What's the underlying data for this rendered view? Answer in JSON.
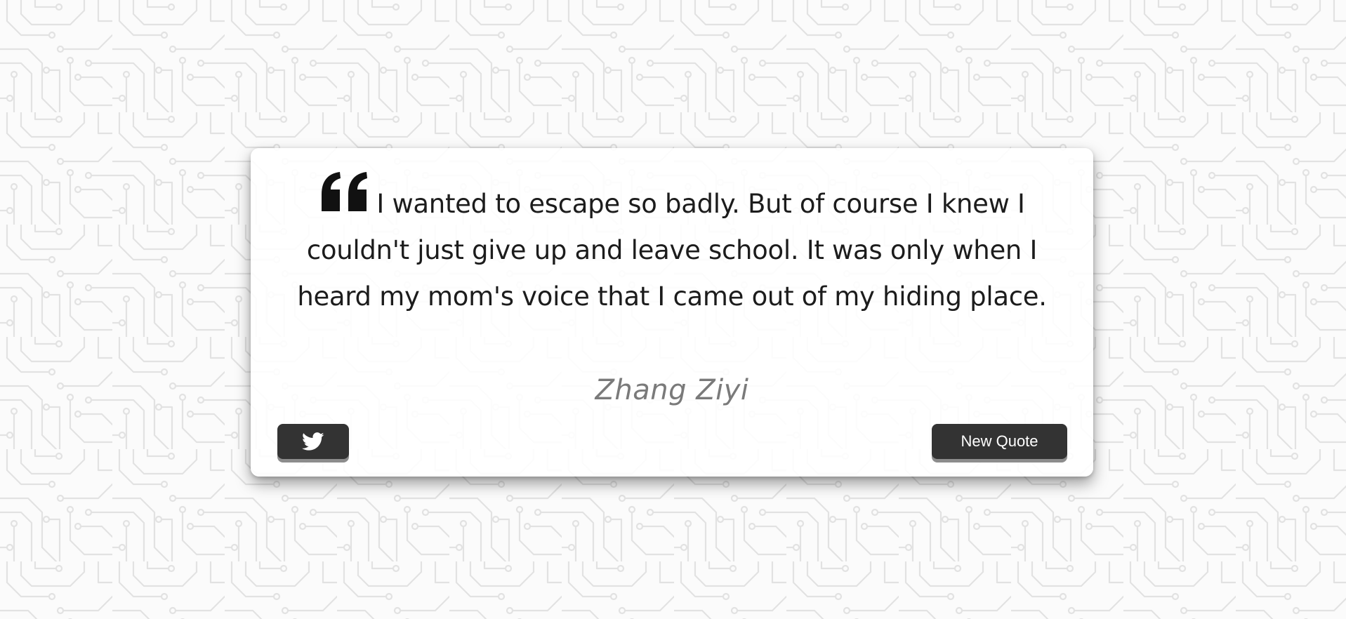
{
  "quote": {
    "text": "I wanted to escape so badly. But of course I knew I couldn't just give up and leave school. It was only when I heard my mom's voice that I came out of my hiding place.",
    "author": "Zhang Ziyi",
    "icon": "quote-left-icon"
  },
  "actions": {
    "tweet_icon": "twitter-icon",
    "new_quote_label": "New Quote"
  },
  "colors": {
    "button_bg": "#333333",
    "button_shadow": "#8c8c8c",
    "author_text": "#7a7a7a",
    "pattern_line": "#e2e2e2",
    "page_bg": "#fbfbfb"
  }
}
